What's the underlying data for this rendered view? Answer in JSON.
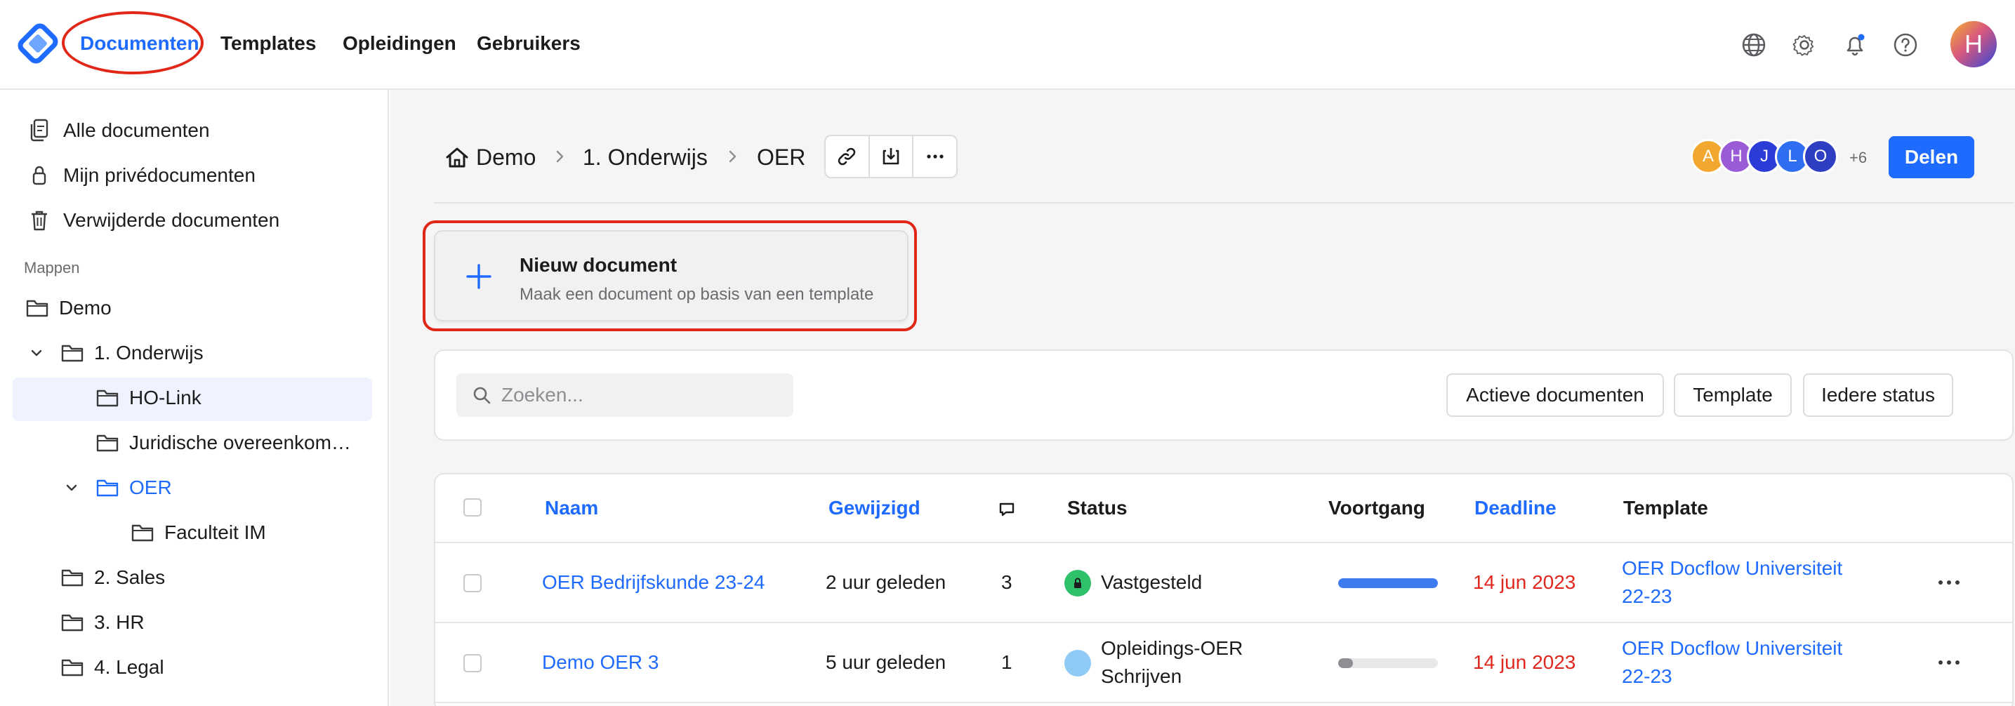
{
  "topnav": {
    "items": [
      "Documenten",
      "Templates",
      "Opleidingen",
      "Gebruikers"
    ],
    "active_index": 0,
    "user_initial": "H",
    "icons": [
      "globe-icon",
      "gear-icon",
      "bell-icon",
      "help-icon"
    ]
  },
  "sidebar": {
    "items": [
      {
        "label": "Alle documenten",
        "icon": "documents-icon"
      },
      {
        "label": "Mijn privédocumenten",
        "icon": "lock-icon"
      },
      {
        "label": "Verwijderde documenten",
        "icon": "trash-icon"
      }
    ],
    "section_title": "Mappen",
    "tree": [
      {
        "label": "Demo",
        "level": 0,
        "expanded": false
      },
      {
        "label": "1. Onderwijs",
        "level": 1,
        "expanded": true
      },
      {
        "label": "HO-Link",
        "level": 2
      },
      {
        "label": "Juridische overeenkom…",
        "level": 2
      },
      {
        "label": "OER",
        "level": 2,
        "expanded": true,
        "selected": true
      },
      {
        "label": "Faculteit IM",
        "level": 3
      },
      {
        "label": "2. Sales",
        "level": 1
      },
      {
        "label": "3. HR",
        "level": 1
      },
      {
        "label": "4. Legal",
        "level": 1
      }
    ]
  },
  "breadcrumb": [
    "Demo",
    "1. Onderwijs",
    "OER"
  ],
  "collaborators": {
    "avatars": [
      {
        "initial": "A",
        "color": "#f2a72e"
      },
      {
        "initial": "H",
        "color": "#9b5bd6"
      },
      {
        "initial": "J",
        "color": "#2a3bd6"
      },
      {
        "initial": "L",
        "color": "#2f6ef0"
      },
      {
        "initial": "O",
        "color": "#2f3fc4"
      }
    ],
    "more_count": "+6"
  },
  "share_label": "Delen",
  "new_document": {
    "title": "Nieuw document",
    "subtitle": "Maak een document op basis van een template"
  },
  "filters": {
    "search_placeholder": "Zoeken...",
    "buttons": [
      "Actieve documenten",
      "Template",
      "Iedere status"
    ]
  },
  "table": {
    "columns": [
      "Naam",
      "Gewijzigd",
      "Status",
      "Voortgang",
      "Deadline",
      "Template"
    ],
    "rows": [
      {
        "name": "OER Bedrijfskunde 23-24",
        "modified": "2 uur geleden",
        "comments": "3",
        "status": "Vastgesteld",
        "status_color": "#2fc16a",
        "progress": 1.0,
        "progress_color": "#3d7cf0",
        "deadline": "14 jun 2023",
        "template_line1": "OER Docflow Universiteit",
        "template_line2": "22-23"
      },
      {
        "name": "Demo OER 3",
        "modified": "5 uur geleden",
        "comments": "1",
        "status_line1": "Opleidings-OER",
        "status_line2": "Schrijven",
        "status_color": "#8fcaf5",
        "progress": 0.15,
        "progress_color": "#8e8e93",
        "deadline": "14 jun 2023",
        "template_line1": "OER Docflow Universiteit",
        "template_line2": "22-23"
      }
    ]
  }
}
